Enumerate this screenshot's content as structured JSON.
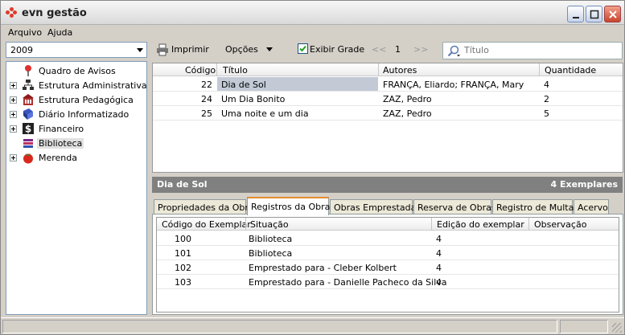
{
  "window": {
    "title": "evn gestão"
  },
  "menu": [
    {
      "label": "Arquivo"
    },
    {
      "label": "Ajuda"
    }
  ],
  "year_select": {
    "value": "2009"
  },
  "tree": [
    {
      "label": "Quadro de Avisos",
      "icon": "pin-icon",
      "expandable": false
    },
    {
      "label": "Estrutura Administrativa",
      "icon": "org-chart-icon",
      "expandable": true
    },
    {
      "label": "Estrutura Pedagógica",
      "icon": "building-icon",
      "expandable": true
    },
    {
      "label": "Diário Informatizado",
      "icon": "book-icon",
      "expandable": true
    },
    {
      "label": "Financeiro",
      "icon": "dollar-icon",
      "expandable": true
    },
    {
      "label": "Biblioteca",
      "icon": "books-icon",
      "expandable": false,
      "selected": true
    },
    {
      "label": "Merenda",
      "icon": "tomato-icon",
      "expandable": true
    }
  ],
  "toolbar": {
    "print_label": "Imprimir",
    "options_label": "Opções",
    "show_grid_label": "Exibir Grade",
    "show_grid_checked": true,
    "first_label": "<<",
    "page": "1",
    "next_label": ">>",
    "search_placeholder": "Título"
  },
  "works_grid": {
    "columns": [
      "Código",
      "Título",
      "Autores",
      "Quantidade"
    ],
    "rows": [
      {
        "codigo": "22",
        "titulo": "Dia de Sol",
        "autores": "FRANÇA, Eliardo; FRANÇA, Mary",
        "quantidade": "4",
        "selected": true
      },
      {
        "codigo": "24",
        "titulo": "Um Dia Bonito",
        "autores": "ZAZ, Pedro",
        "quantidade": "2"
      },
      {
        "codigo": "25",
        "titulo": "Uma noite e um dia",
        "autores": "ZAZ, Pedro",
        "quantidade": "5"
      }
    ]
  },
  "detail": {
    "title": "Dia de Sol",
    "count": "4 Exemplares"
  },
  "tabs": [
    {
      "label": "Propriedades da Obra"
    },
    {
      "label": "Registros da Obra",
      "active": true
    },
    {
      "label": "Obras Emprestadas"
    },
    {
      "label": "Reserva de Obras"
    },
    {
      "label": "Registro de Multas"
    },
    {
      "label": "Acervo"
    }
  ],
  "copies_grid": {
    "columns": [
      "Código do Exemplar",
      "Situação",
      "Edição do exemplar",
      "Observação"
    ],
    "rows": [
      {
        "codigo": "100",
        "situacao": "Biblioteca",
        "edicao": "4",
        "observacao": ""
      },
      {
        "codigo": "101",
        "situacao": "Biblioteca",
        "edicao": "4",
        "observacao": ""
      },
      {
        "codigo": "102",
        "situacao": "Emprestado para - Cleber Kolbert",
        "edicao": "4",
        "observacao": ""
      },
      {
        "codigo": "103",
        "situacao": "Emprestado para - Danielle Pacheco da Silva",
        "edicao": "4",
        "observacao": ""
      }
    ]
  },
  "colors": {
    "accent_tab": "#e68b2c",
    "detail_bar": "#808080",
    "selection": "#c3cad6"
  }
}
